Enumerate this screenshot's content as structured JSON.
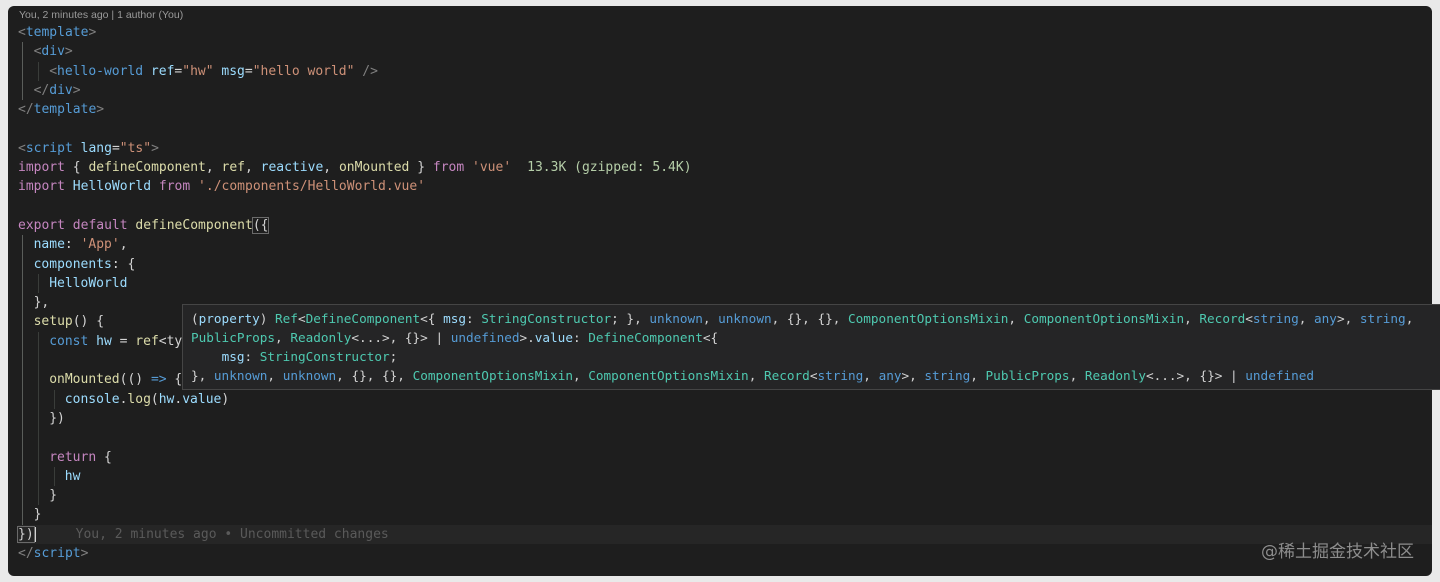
{
  "codelens": "You, 2 minutes ago | 1 author (You)",
  "code": {
    "l1": {
      "lt": "<",
      "tag": "template",
      "gt": ">"
    },
    "l2": {
      "lt": "<",
      "tag": "div",
      "gt": ">"
    },
    "l3": {
      "lt": "<",
      "tag": "hello-world",
      "attr1": " ref",
      "eq1": "=",
      "val1": "\"hw\"",
      "attr2": " msg",
      "eq2": "=",
      "val2": "\"hello world\"",
      "close": " />"
    },
    "l4": {
      "lt": "</",
      "tag": "div",
      "gt": ">"
    },
    "l5": {
      "lt": "</",
      "tag": "template",
      "gt": ">"
    },
    "l7": {
      "lt": "<",
      "tag": "script",
      "attr": " lang",
      "eq": "=",
      "val": "\"ts\"",
      "gt": ">"
    },
    "l8": {
      "kw": "import",
      "p1": " { ",
      "f1": "defineComponent",
      "c1": ", ",
      "f2": "ref",
      "c2": ", ",
      "f3": "reactive",
      "c3": ", ",
      "f4": "onMounted",
      "p2": " } ",
      "from": "from",
      "sp": " ",
      "str": "'vue'",
      "size": "13.3K (gzipped: 5.4K)"
    },
    "l9": {
      "kw": "import",
      "sp": " ",
      "cls": "HelloWorld",
      "sp2": " ",
      "from": "from",
      "sp3": " ",
      "str": "'./components/HelloWorld.vue'"
    },
    "l11": {
      "kw1": "export",
      "sp": " ",
      "kw2": "default",
      "sp2": " ",
      "fn": "defineComponent",
      "p": "({"
    },
    "l12": {
      "key": "name",
      "colon": ": ",
      "str": "'App'",
      "comma": ","
    },
    "l13": {
      "key": "components",
      "rest": ": {"
    },
    "l14": {
      "cls": "HelloWorld"
    },
    "l15": {
      "text": "},"
    },
    "l16": {
      "fn": "setup",
      "rest": "() {"
    },
    "l17": {
      "kw": "const",
      "sp": " ",
      "var": "hw",
      "eq": " = ",
      "fn": "ref",
      "rest": "<ty"
    },
    "l19": {
      "fn": "onMounted",
      "p1": "(() ",
      "arrow": "=>",
      "p2": " {"
    },
    "l20": {
      "var": "console",
      "dot": ".",
      "fn": "log",
      "p1": "(",
      "var2": "hw",
      "dot2": ".",
      "var3": "value",
      "p2": ")"
    },
    "l21": {
      "text": "})"
    },
    "l23": {
      "kw": "return",
      "rest": " {"
    },
    "l24": {
      "var": "hw"
    },
    "l25": {
      "text": "}"
    },
    "l26": {
      "text": "}"
    },
    "l27": {
      "text": "})",
      "blame": "You, 2 minutes ago • Uncommitted changes"
    },
    "l28": {
      "lt": "</",
      "tag": "script",
      "gt": ">"
    }
  },
  "hover": {
    "line1": "(property) Ref<DefineComponent<{ msg: StringConstructor; }, unknown, unknown, {}, {}, ComponentOptionsMixin, ComponentOptionsMixin, Record<string, any>, string,",
    "line2": "PublicProps, Readonly<...>, {}> | undefined>.value: DefineComponent<{",
    "line3": "    msg: StringConstructor;",
    "line4": "}, unknown, unknown, {}, {}, ComponentOptionsMixin, ComponentOptionsMixin, Record<string, any>, string, PublicProps, Readonly<...>, {}> | undefined"
  },
  "watermark": "@稀土掘金技术社区",
  "colors": {
    "bg": "#1e1e1e",
    "tag": "#569cd6",
    "string": "#ce9178",
    "keyword": "#c586c0",
    "function": "#dcdcaa",
    "variable": "#9cdcfe",
    "class": "#4ec9b0"
  }
}
